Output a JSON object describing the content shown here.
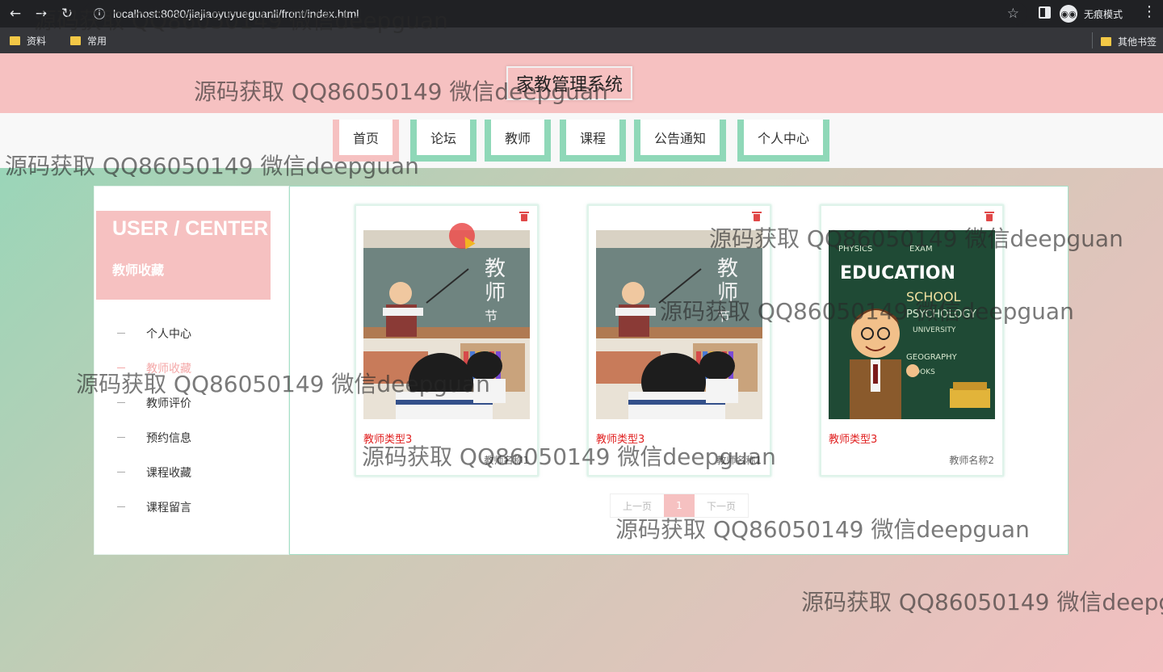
{
  "browser": {
    "url": "localhost:8080/jiajiaoyuyueguanli/front/index.html",
    "incognito_label": "无痕模式",
    "bookmarks": [
      "资料",
      "常用"
    ],
    "other_bookmarks": "其他书签"
  },
  "site": {
    "title": "家教管理系统",
    "nav": [
      "首页",
      "论坛",
      "教师",
      "课程",
      "公告通知",
      "个人中心"
    ]
  },
  "sidebar": {
    "title": "USER / CENTER",
    "subtitle": "教师收藏",
    "items": [
      "个人中心",
      "教师收藏",
      "教师评价",
      "预约信息",
      "课程收藏",
      "课程留言"
    ]
  },
  "cards": [
    {
      "type": "教师类型3",
      "name": "教师名称1",
      "image": "teacher-day-poster"
    },
    {
      "type": "教师类型3",
      "name": "教师名称1",
      "image": "teacher-day-poster"
    },
    {
      "type": "教师类型3",
      "name": "教师名称2",
      "image": "education-chalkboard-teacher"
    }
  ],
  "pagination": {
    "prev": "上一页",
    "current": "1",
    "next": "下一页"
  },
  "watermark_text": "源码获取 QQ86050149 微信deepguan",
  "colors": {
    "pink": "#f6c1c1",
    "mint": "#8fd8b8",
    "red": "#e02020"
  }
}
